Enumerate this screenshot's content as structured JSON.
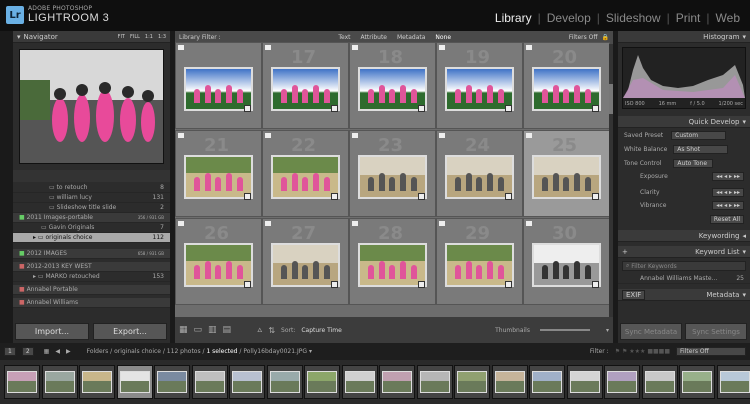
{
  "titlebar": {
    "logo": "Lr",
    "brand_small": "ADOBE PHOTOSHOP",
    "brand_large": "LIGHTROOM 3",
    "modules": [
      {
        "label": "Library",
        "active": true
      },
      {
        "label": "Develop"
      },
      {
        "label": "Slideshow"
      },
      {
        "label": "Print"
      },
      {
        "label": "Web"
      }
    ]
  },
  "left": {
    "navigator": {
      "title": "Navigator",
      "zoom": [
        "FIT",
        "FILL",
        "1:1",
        "1:3"
      ]
    },
    "folders": [
      {
        "name": "to retouch",
        "count": "8"
      },
      {
        "name": "william lucy",
        "count": "131"
      },
      {
        "name": "Slideshow title slide",
        "count": "2"
      }
    ],
    "sections": [
      {
        "name": "2011 Images-portable",
        "meta": "356 / 931 GB",
        "items": [
          {
            "name": "Gavin Originals",
            "count": "7"
          },
          {
            "name": "originals choice",
            "count": "112",
            "selected": true
          }
        ]
      },
      {
        "name": "2012 IMAGES",
        "meta": "658 / 931 GB"
      },
      {
        "name": "2012-2013 KEY WEST",
        "items": [
          {
            "name": "MARKO retouched",
            "count": "153"
          }
        ]
      },
      {
        "name": "Annabel Portable"
      },
      {
        "name": "Annabel Williams"
      }
    ],
    "import_label": "Import...",
    "export_label": "Export..."
  },
  "filter": {
    "label": "Library Filter :",
    "options": [
      "Text",
      "Attribute",
      "Metadata",
      "None"
    ],
    "filters_off": "Filters Off"
  },
  "grid": {
    "rows": [
      [
        "",
        "17",
        "18",
        "19",
        "20"
      ],
      [
        "21",
        "22",
        "23",
        "24",
        "25"
      ],
      [
        "26",
        "27",
        "28",
        "29",
        "30"
      ]
    ]
  },
  "toolbar": {
    "sort_label": "Sort:",
    "sort_value": "Capture Time",
    "thumbs_label": "Thumbnails"
  },
  "right": {
    "histogram": {
      "title": "Histogram",
      "iso": "ISO 800",
      "focal": "16 mm",
      "aperture": "f / 5.0",
      "shutter": "1/200 sec"
    },
    "quick_develop": {
      "title": "Quick Develop",
      "saved_preset_label": "Saved Preset",
      "saved_preset": "Custom",
      "wb_label": "White Balance",
      "wb": "As Shot",
      "tone_label": "Tone Control",
      "auto_tone": "Auto Tone",
      "exposure": "Exposure",
      "clarity": "Clarity",
      "vibrance": "Vibrance",
      "reset": "Reset All"
    },
    "keywording": {
      "title": "Keywording"
    },
    "keyword_list": {
      "title": "Keyword List",
      "placeholder": "Filter Keywords",
      "item": "Annabel Williams Maste...",
      "item_count": "25"
    },
    "metadata": {
      "title": "Metadata",
      "preset": "EXIF"
    },
    "sync_meta": "Sync Metadata",
    "sync_settings": "Sync Settings"
  },
  "filmstrip": {
    "pages": [
      "1",
      "2"
    ],
    "path": "Folders / originals choice / 112 photos / ",
    "selected": "1 selected",
    "file": "/ Polly16bday0021.JPG",
    "filter": "Filter :",
    "filters_off": "Filters Off"
  }
}
